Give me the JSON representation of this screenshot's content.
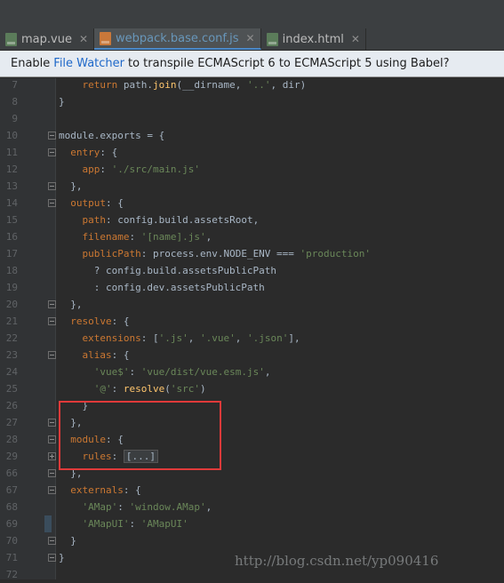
{
  "tabs": [
    {
      "label": "map.vue",
      "icon": "vue-file-icon",
      "active": false
    },
    {
      "label": "webpack.base.conf.js",
      "icon": "js-file-icon",
      "active": true
    },
    {
      "label": "index.html",
      "icon": "html-file-icon",
      "active": false
    }
  ],
  "banner": {
    "prefix": "Enable",
    "link": "File Watcher",
    "suffix": "to transpile ECMAScript 6 to ECMAScript 5 using Babel?"
  },
  "code_lines": [
    {
      "num": "7",
      "tokens": [
        [
          "kw",
          "    return "
        ],
        [
          "plain",
          "path."
        ],
        [
          "fn",
          "join"
        ],
        [
          "plain",
          "(__dirname, "
        ],
        [
          "str",
          "'..'"
        ],
        [
          "plain",
          ", dir)"
        ]
      ]
    },
    {
      "num": "8",
      "tokens": [
        [
          "plain",
          "}"
        ]
      ]
    },
    {
      "num": "9",
      "tokens": [
        [
          "plain",
          ""
        ]
      ]
    },
    {
      "num": "10",
      "tokens": [
        [
          "plain",
          "module.exports = {"
        ]
      ]
    },
    {
      "num": "11",
      "tokens": [
        [
          "plain",
          "  "
        ],
        [
          "kw",
          "entry"
        ],
        [
          "plain",
          ": {"
        ]
      ]
    },
    {
      "num": "12",
      "tokens": [
        [
          "plain",
          "    "
        ],
        [
          "kw",
          "app"
        ],
        [
          "plain",
          ": "
        ],
        [
          "str",
          "'./src/main.js'"
        ]
      ]
    },
    {
      "num": "13",
      "tokens": [
        [
          "plain",
          "  },"
        ]
      ]
    },
    {
      "num": "14",
      "tokens": [
        [
          "plain",
          "  "
        ],
        [
          "kw",
          "output"
        ],
        [
          "plain",
          ": {"
        ]
      ]
    },
    {
      "num": "15",
      "tokens": [
        [
          "plain",
          "    "
        ],
        [
          "kw",
          "path"
        ],
        [
          "plain",
          ": config.build.assetsRoot,"
        ]
      ]
    },
    {
      "num": "16",
      "tokens": [
        [
          "plain",
          "    "
        ],
        [
          "kw",
          "filename"
        ],
        [
          "plain",
          ": "
        ],
        [
          "str",
          "'[name].js'"
        ],
        [
          "plain",
          ","
        ]
      ]
    },
    {
      "num": "17",
      "tokens": [
        [
          "plain",
          "    "
        ],
        [
          "kw",
          "publicPath"
        ],
        [
          "plain",
          ": process.env.NODE_ENV === "
        ],
        [
          "str",
          "'production'"
        ]
      ]
    },
    {
      "num": "18",
      "tokens": [
        [
          "plain",
          "      ? config.build.assetsPublicPath"
        ]
      ]
    },
    {
      "num": "19",
      "tokens": [
        [
          "plain",
          "      : config.dev.assetsPublicPath"
        ]
      ]
    },
    {
      "num": "20",
      "tokens": [
        [
          "plain",
          "  },"
        ]
      ]
    },
    {
      "num": "21",
      "tokens": [
        [
          "plain",
          "  "
        ],
        [
          "kw",
          "resolve"
        ],
        [
          "plain",
          ": {"
        ]
      ]
    },
    {
      "num": "22",
      "tokens": [
        [
          "plain",
          "    "
        ],
        [
          "kw",
          "extensions"
        ],
        [
          "plain",
          ": ["
        ],
        [
          "str",
          "'.js'"
        ],
        [
          "plain",
          ", "
        ],
        [
          "str",
          "'.vue'"
        ],
        [
          "plain",
          ", "
        ],
        [
          "str",
          "'.json'"
        ],
        [
          "plain",
          "],"
        ]
      ]
    },
    {
      "num": "23",
      "tokens": [
        [
          "plain",
          "    "
        ],
        [
          "kw",
          "alias"
        ],
        [
          "plain",
          ": {"
        ]
      ]
    },
    {
      "num": "24",
      "tokens": [
        [
          "plain",
          "      "
        ],
        [
          "str",
          "'vue$'"
        ],
        [
          "plain",
          ": "
        ],
        [
          "str",
          "'vue/dist/vue.esm.js'"
        ],
        [
          "plain",
          ","
        ]
      ]
    },
    {
      "num": "25",
      "tokens": [
        [
          "plain",
          "      "
        ],
        [
          "str",
          "'@'"
        ],
        [
          "plain",
          ": "
        ],
        [
          "fn",
          "resolve"
        ],
        [
          "plain",
          "("
        ],
        [
          "str",
          "'src'"
        ],
        [
          "plain",
          ")"
        ]
      ]
    },
    {
      "num": "26",
      "tokens": [
        [
          "plain",
          "    }"
        ]
      ]
    },
    {
      "num": "27",
      "tokens": [
        [
          "plain",
          "  },"
        ]
      ]
    },
    {
      "num": "28",
      "tokens": [
        [
          "plain",
          "  "
        ],
        [
          "kw",
          "module"
        ],
        [
          "plain",
          ": {"
        ]
      ]
    },
    {
      "num": "29",
      "tokens": [
        [
          "plain",
          "    "
        ],
        [
          "kw",
          "rules"
        ],
        [
          "plain",
          ": "
        ],
        [
          "folded",
          "[...]"
        ]
      ]
    },
    {
      "num": "66",
      "tokens": [
        [
          "plain",
          "  },"
        ]
      ]
    },
    {
      "num": "67",
      "tokens": [
        [
          "plain",
          "  "
        ],
        [
          "kw",
          "externals"
        ],
        [
          "plain",
          ": {"
        ]
      ]
    },
    {
      "num": "68",
      "tokens": [
        [
          "plain",
          "    "
        ],
        [
          "str",
          "'AMap'"
        ],
        [
          "plain",
          ": "
        ],
        [
          "str",
          "'window.AMap'"
        ],
        [
          "plain",
          ","
        ]
      ]
    },
    {
      "num": "69",
      "tokens": [
        [
          "plain",
          "    "
        ],
        [
          "str",
          "'AMapUI'"
        ],
        [
          "plain",
          ": "
        ],
        [
          "str",
          "'AMapUI'"
        ]
      ]
    },
    {
      "num": "70",
      "tokens": [
        [
          "plain",
          "  }"
        ]
      ]
    },
    {
      "num": "71",
      "tokens": [
        [
          "plain",
          "}"
        ]
      ]
    },
    {
      "num": "72",
      "tokens": [
        [
          "plain",
          ""
        ]
      ]
    }
  ],
  "watermark": "http://blog.csdn.net/yp090416",
  "colors": {
    "editor_bg": "#2b2b2b",
    "keyword": "#cc7832",
    "string": "#6a8759",
    "function": "#ffc66d",
    "highlight_border": "#e03a3a",
    "link": "#1e68c9"
  }
}
